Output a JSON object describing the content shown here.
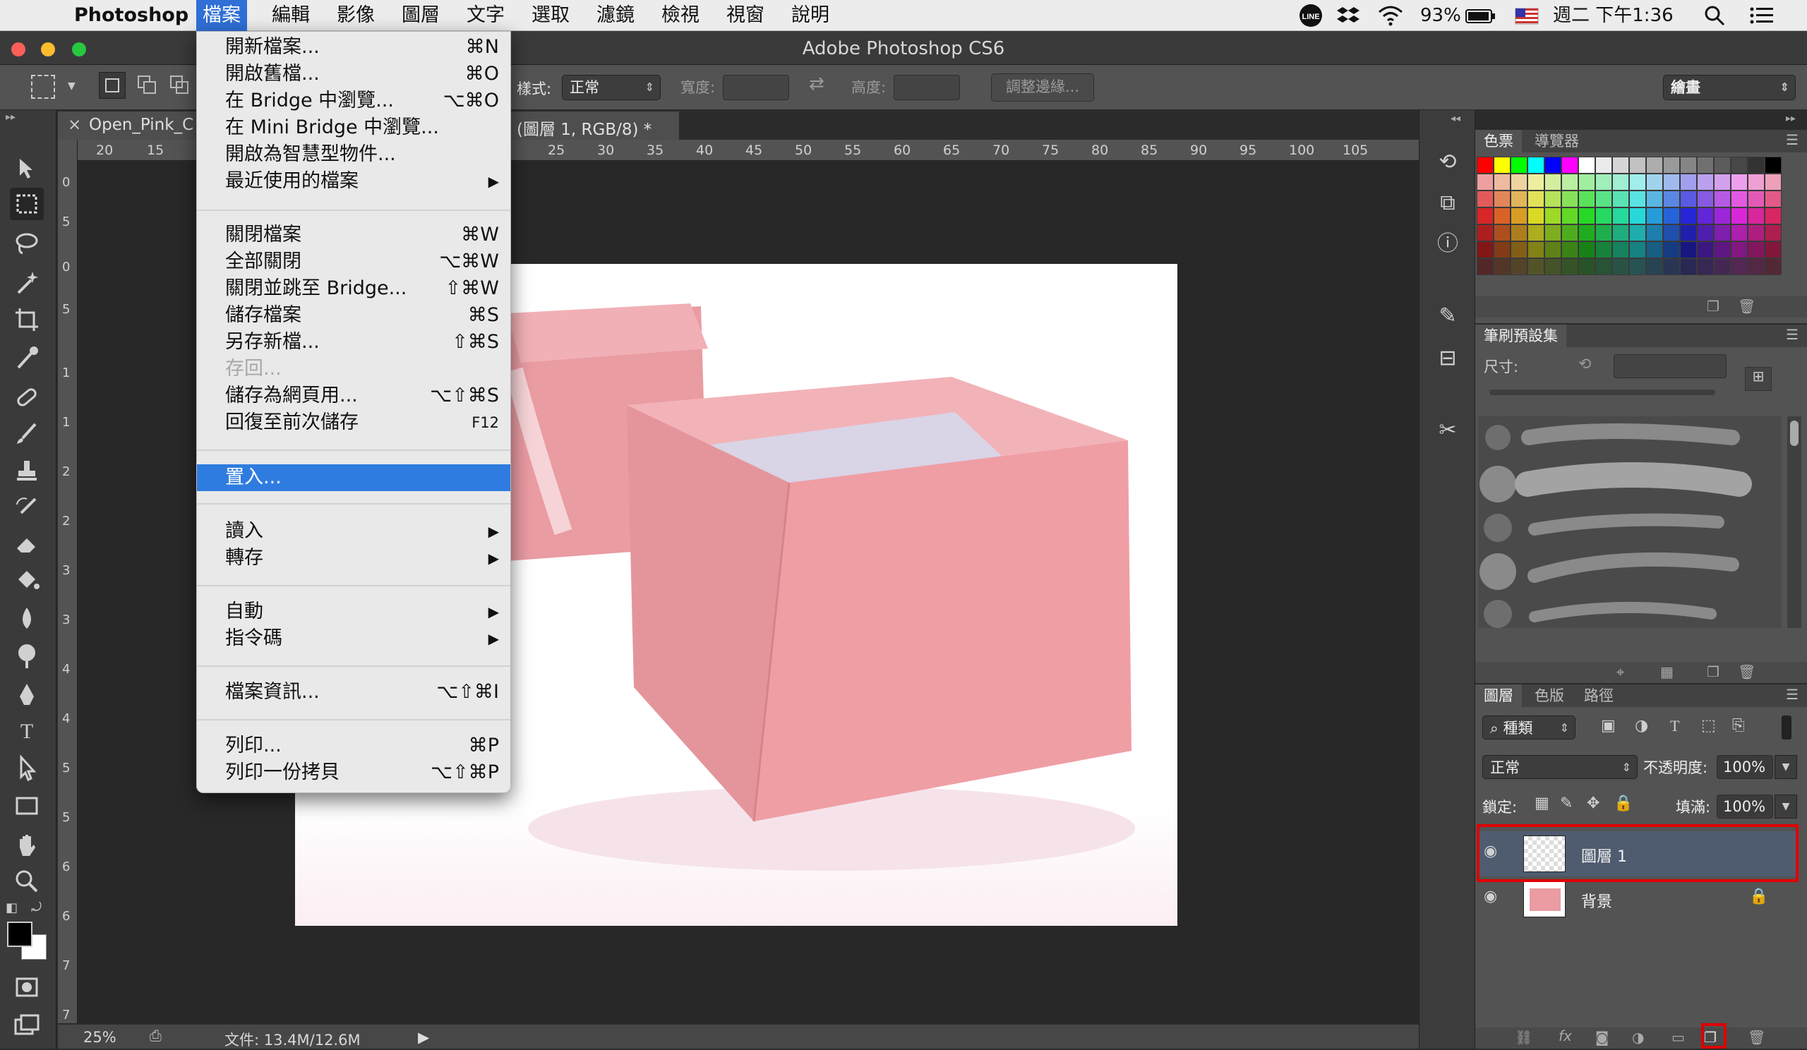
{
  "menubar": {
    "app_name": "Photoshop",
    "items": [
      "檔案",
      "編輯",
      "影像",
      "圖層",
      "文字",
      "選取",
      "濾鏡",
      "檢視",
      "視窗",
      "說明"
    ],
    "battery": "93%",
    "clock": "週二 下午1:36"
  },
  "window": {
    "title": "Adobe Photoshop CS6"
  },
  "options": {
    "style_label": "樣式:",
    "style_value": "正常",
    "width_label": "寬度:",
    "height_label": "高度:",
    "refine_edge": "調整邊緣...",
    "workspace": "繪畫"
  },
  "document": {
    "tab_name": "Open_Pink_C",
    "tab_info": "(圖層 1, RGB/8) *",
    "zoom": "25%",
    "doc_info": "文件: 13.4M/12.6M",
    "ruler_h": [
      "20",
      "15",
      "25",
      "30",
      "35",
      "40",
      "45",
      "50",
      "55",
      "60",
      "65",
      "70",
      "75",
      "80",
      "85",
      "90",
      "95",
      "100",
      "105"
    ],
    "ruler_v": [
      "0",
      "5",
      "0",
      "5",
      "1",
      "1",
      "2",
      "2",
      "3",
      "3",
      "4",
      "4",
      "5",
      "5",
      "6",
      "6",
      "7",
      "7"
    ]
  },
  "file_menu": {
    "groups": [
      [
        {
          "label": "開新檔案...",
          "shortcut": "⌘N"
        },
        {
          "label": "開啟舊檔...",
          "shortcut": "⌘O"
        },
        {
          "label": "在 Bridge 中瀏覽...",
          "shortcut": "⌥⌘O"
        },
        {
          "label": "在 Mini Bridge 中瀏覽...",
          "shortcut": ""
        },
        {
          "label": "開啟為智慧型物件...",
          "shortcut": ""
        },
        {
          "label": "最近使用的檔案",
          "shortcut": "▶"
        }
      ],
      [
        {
          "label": "關閉檔案",
          "shortcut": "⌘W"
        },
        {
          "label": "全部關閉",
          "shortcut": "⌥⌘W"
        },
        {
          "label": "關閉並跳至 Bridge...",
          "shortcut": "⇧⌘W"
        },
        {
          "label": "儲存檔案",
          "shortcut": "⌘S"
        },
        {
          "label": "另存新檔...",
          "shortcut": "⇧⌘S"
        },
        {
          "label": "存回...",
          "shortcut": ""
        },
        {
          "label": "儲存為網頁用...",
          "shortcut": "⌥⇧⌘S"
        },
        {
          "label": "回復至前次儲存",
          "shortcut": "F12"
        }
      ],
      [
        {
          "label": "置入...",
          "shortcut": ""
        }
      ],
      [
        {
          "label": "讀入",
          "shortcut": "▶"
        },
        {
          "label": "轉存",
          "shortcut": "▶"
        }
      ],
      [
        {
          "label": "自動",
          "shortcut": "▶"
        },
        {
          "label": "指令碼",
          "shortcut": "▶"
        }
      ],
      [
        {
          "label": "檔案資訊...",
          "shortcut": "⌥⇧⌘I"
        }
      ],
      [
        {
          "label": "列印...",
          "shortcut": "⌘P"
        },
        {
          "label": "列印一份拷貝",
          "shortcut": "⌥⇧⌘P"
        }
      ]
    ]
  },
  "panels": {
    "swatches_tab": "色票",
    "navigator_tab": "導覽器",
    "brush_presets_tab": "筆刷預設集",
    "size_label": "尺寸:",
    "layers_tab": "圖層",
    "channels_tab": "色版",
    "paths_tab": "路徑",
    "kind_filter": "種類",
    "blend_mode": "正常",
    "opacity_label": "不透明度:",
    "opacity_value": "100%",
    "lock_label": "鎖定:",
    "fill_label": "填滿:",
    "fill_value": "100%",
    "layers": [
      {
        "name": "圖層 1",
        "selected": true
      },
      {
        "name": "背景",
        "selected": false
      }
    ]
  },
  "colors": {
    "accent": "#2f7ce0",
    "highlight_box": "#e00000",
    "box_pink": "#eea3a7"
  }
}
